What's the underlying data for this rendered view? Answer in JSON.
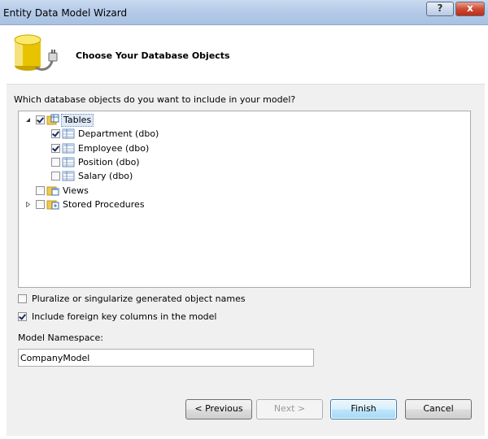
{
  "window": {
    "title": "Entity Data Model Wizard",
    "help_label": "?",
    "close_label": "x"
  },
  "header": {
    "title": "Choose Your Database Objects",
    "icon": "database-connection-icon"
  },
  "tree": {
    "question": "Which database objects do you want to include in your model?",
    "nodes": [
      {
        "label": "Tables",
        "checked": true,
        "expanded": true,
        "icon": "tables-folder-icon"
      },
      {
        "label": "Department (dbo)",
        "checked": true,
        "icon": "table-icon"
      },
      {
        "label": "Employee (dbo)",
        "checked": true,
        "icon": "table-icon"
      },
      {
        "label": "Position (dbo)",
        "checked": false,
        "icon": "table-icon"
      },
      {
        "label": "Salary (dbo)",
        "checked": false,
        "icon": "table-icon"
      },
      {
        "label": "Views",
        "checked": false,
        "icon": "views-folder-icon"
      },
      {
        "label": "Stored Procedures",
        "checked": false,
        "expanded": false,
        "icon": "procedures-folder-icon"
      }
    ]
  },
  "options": {
    "pluralize_label": "Pluralize or singularize generated object names",
    "pluralize_checked": false,
    "foreign_keys_label": "Include foreign key columns in the model",
    "foreign_keys_checked": true
  },
  "namespace": {
    "label": "Model Namespace:",
    "value": "CompanyModel"
  },
  "buttons": {
    "previous": "< Previous",
    "next": "Next >",
    "finish": "Finish",
    "cancel": "Cancel"
  }
}
